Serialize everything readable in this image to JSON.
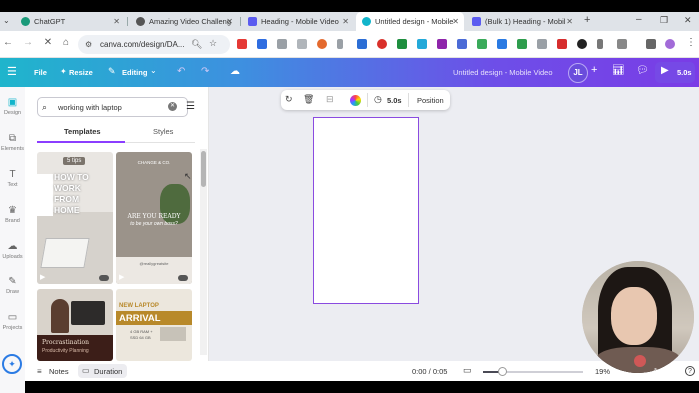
{
  "browser": {
    "tabs": [
      {
        "title": "ChatGPT",
        "fav": "#10a37f"
      },
      {
        "title": "Amazing Video Challeng",
        "fav": "#444"
      },
      {
        "title": "Heading - Mobile Video",
        "fav": "#5c5cf0"
      },
      {
        "title": "Untitled design - Mobile",
        "fav": "#12b5cb"
      },
      {
        "title": "(Bulk 1) Heading - Mobil",
        "fav": "#5c5cf0"
      }
    ],
    "url": "canva.com/design/DA...",
    "new_tab": "+"
  },
  "header": {
    "file": "File",
    "resize": "Resize",
    "editing": "Editing",
    "doc_title": "Untitled design - Mobile Video",
    "avatar": "JL",
    "duration": "5.0s"
  },
  "rail": [
    {
      "label": "Design",
      "icon": "design-icon"
    },
    {
      "label": "Elements",
      "icon": "elements-icon"
    },
    {
      "label": "Text",
      "icon": "text-icon"
    },
    {
      "label": "Brand",
      "icon": "brand-icon"
    },
    {
      "label": "Uploads",
      "icon": "uploads-icon"
    },
    {
      "label": "Draw",
      "icon": "draw-icon"
    },
    {
      "label": "Projects",
      "icon": "projects-icon"
    }
  ],
  "panel": {
    "search_value": "working with laptop",
    "tab_templates": "Templates",
    "tab_styles": "Styles",
    "thumbs": [
      {
        "badge": "5 tips",
        "lines": [
          "HOW TO",
          "WORK",
          "FROM",
          "HOME"
        ]
      },
      {
        "top": "CHANGE & CO.",
        "lines": [
          "ARE YOU READY",
          "to be your own boss?"
        ],
        "handle": "@reallygreatsite"
      },
      {
        "lines": [
          "Procrastination",
          "Productivity Planning"
        ]
      },
      {
        "lines": [
          "NEW LAPTOP",
          "ARRIVAL"
        ],
        "specs": [
          "4 GB RAM +",
          "SSD 64 GB"
        ]
      }
    ]
  },
  "toolbar": {
    "duration": "5.0s",
    "position": "Position"
  },
  "footer": {
    "notes": "Notes",
    "duration": "Duration",
    "time": "0:00 / 0:05",
    "zoom": "19%",
    "playhead_fraction": 0.19
  }
}
